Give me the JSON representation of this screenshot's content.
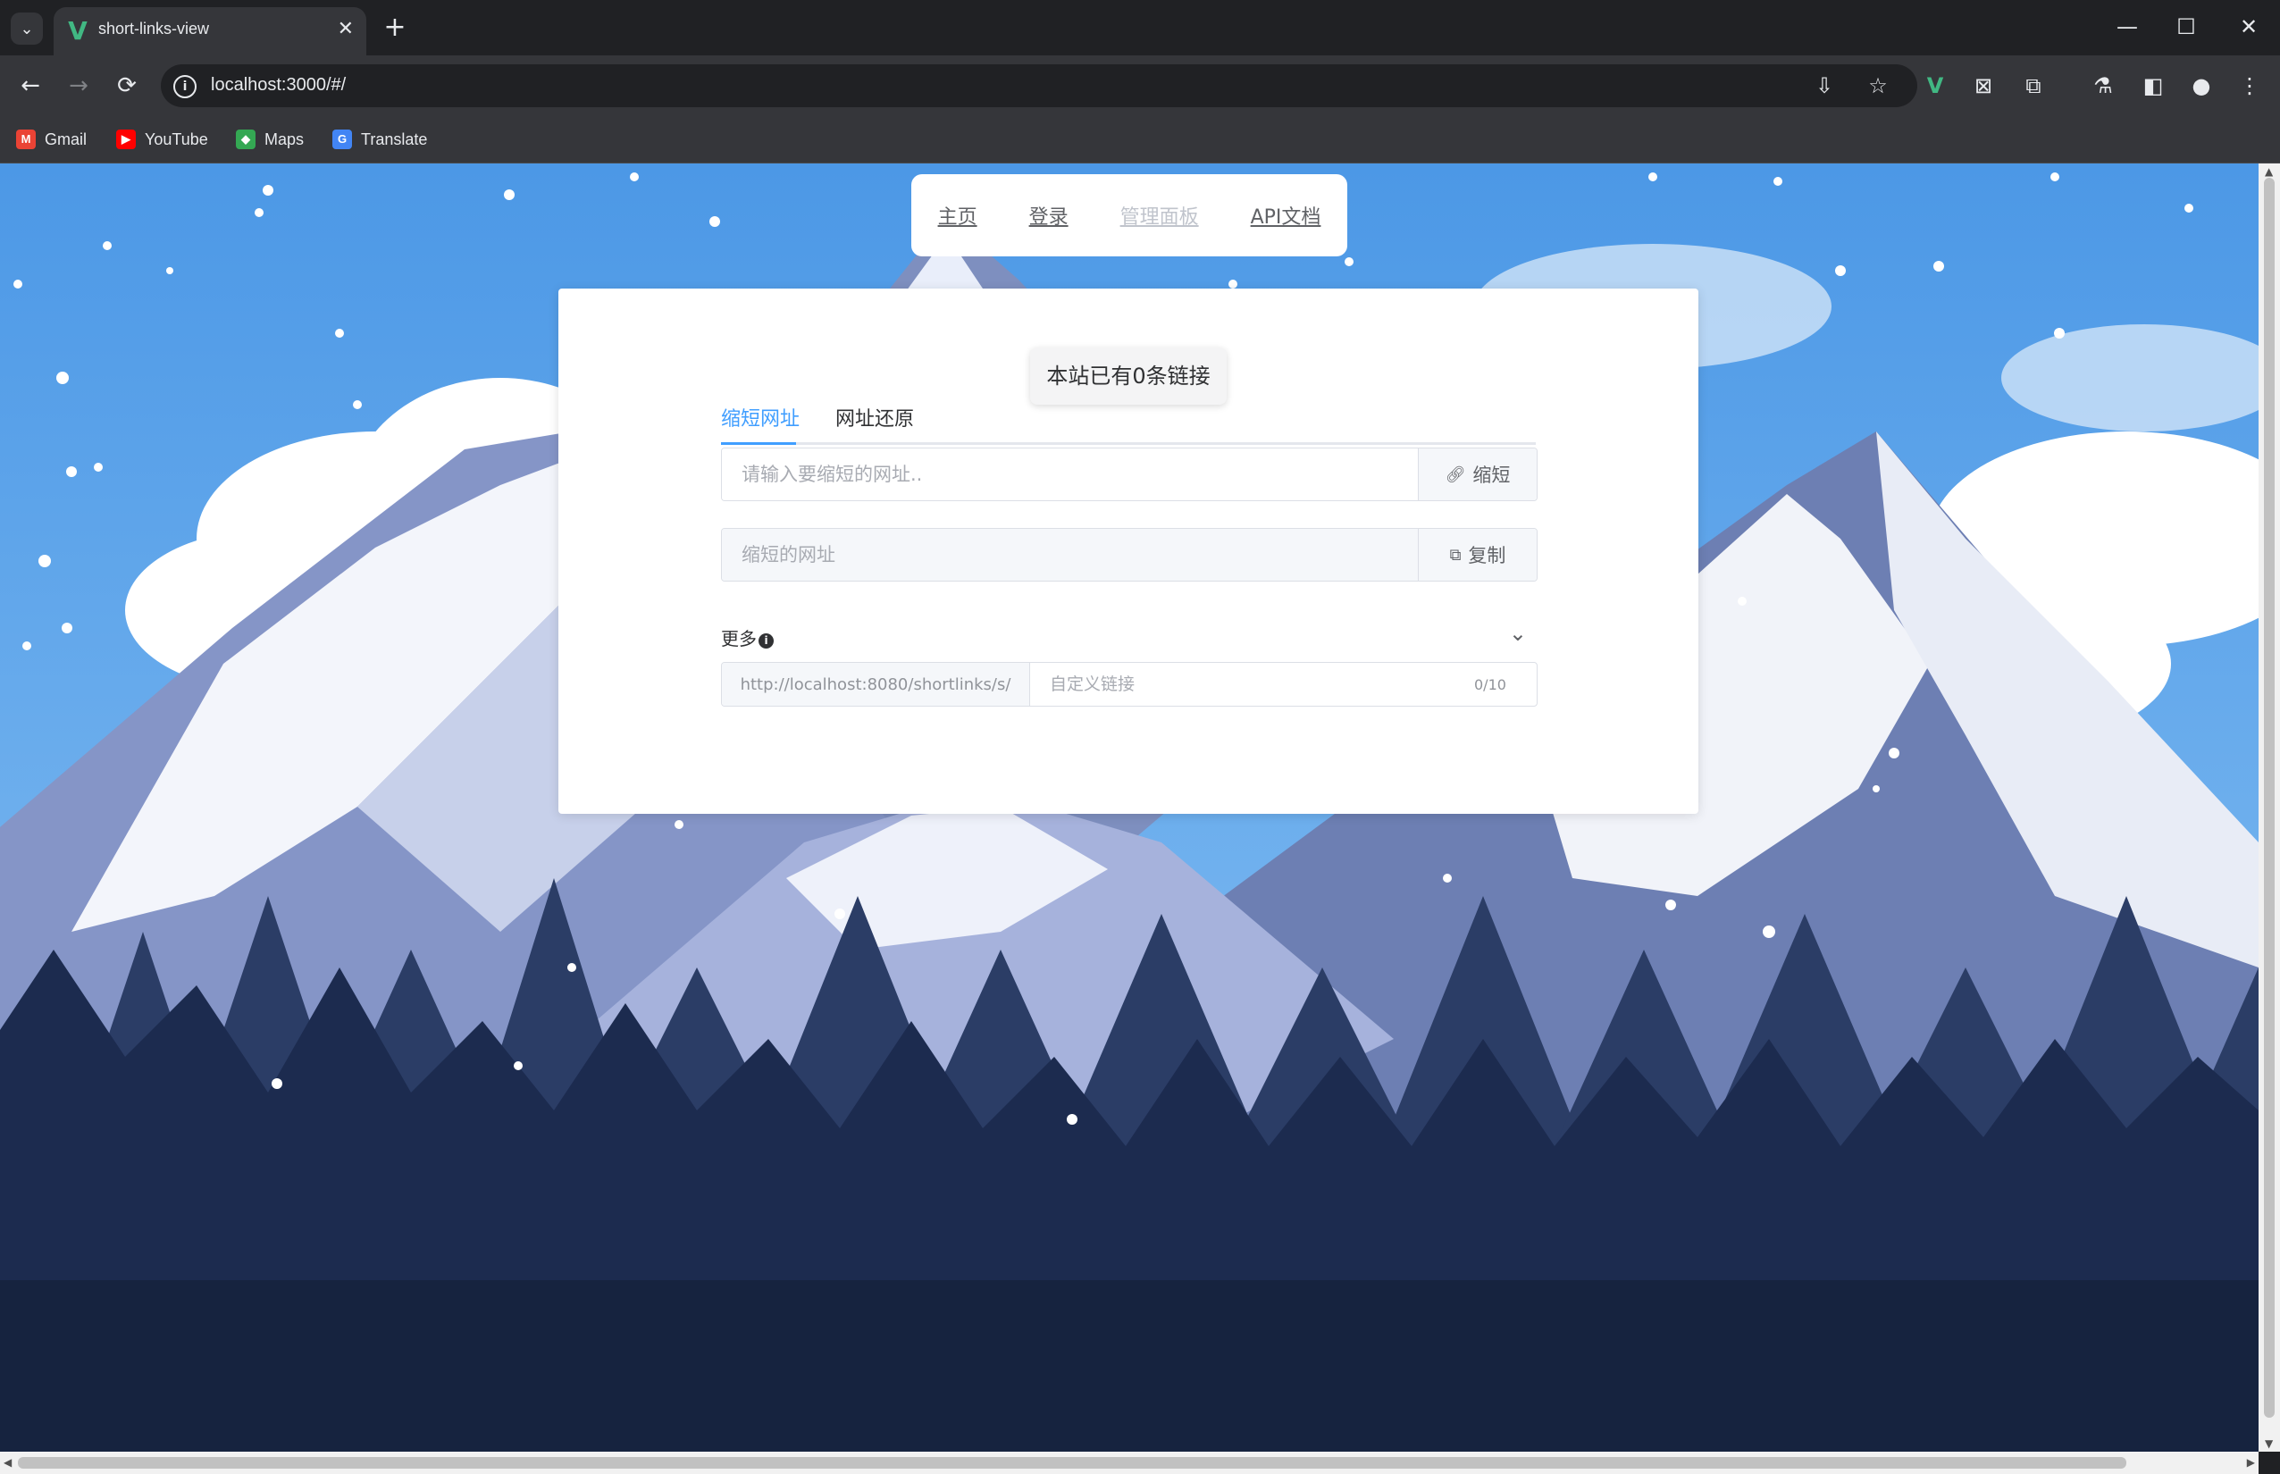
{
  "browser": {
    "tab_title": "short-links-view",
    "url": "localhost:3000/#/",
    "bookmarks": [
      "Gmail",
      "YouTube",
      "Maps",
      "Translate"
    ]
  },
  "page": {
    "nav": [
      "主页",
      "登录",
      "管理面板",
      "API文档"
    ],
    "stat_text": "本站已有0条链接",
    "tabs": [
      "缩短网址",
      "网址还原"
    ],
    "url_input_placeholder": "请输入要缩短的网址..",
    "shorten_button": "缩短",
    "result_placeholder": "缩短的网址",
    "copy_button": "复制",
    "more_label": "更多",
    "custom_prefix": "http://localhost:8080/shortlinks/s/",
    "custom_placeholder": "自定义链接",
    "custom_counter": "0/10"
  },
  "colors": {
    "accent": "#409eff",
    "vue_green": "#41b883",
    "sky": "#5aa6ea",
    "forest": "#16233f"
  }
}
